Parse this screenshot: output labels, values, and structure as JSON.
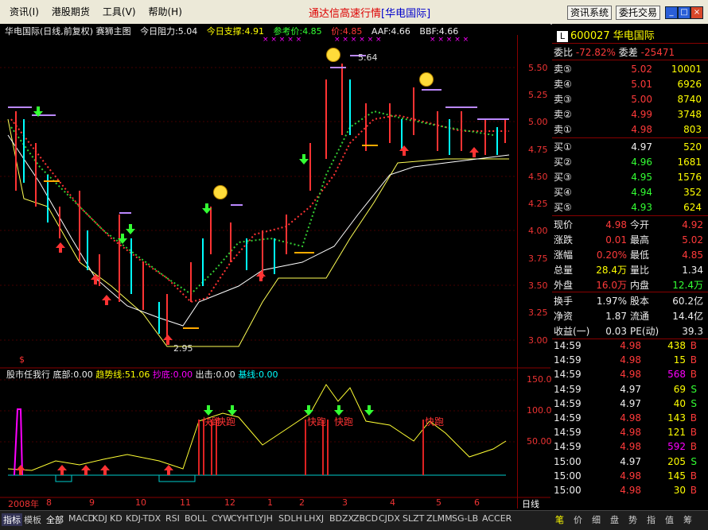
{
  "menu": {
    "items": [
      "资讯(I)",
      "港股期货",
      "工具(V)",
      "帮助(H)"
    ]
  },
  "app_title": "通达信高速行情",
  "app_broker": "[华电国际]",
  "toolbar": {
    "info_system": "资讯系统",
    "trade": "委托交易"
  },
  "chart_header": {
    "name": "华电国际(日线,前复权) 赛狮主图",
    "resistance": "今日阻力:5.04",
    "support": "今日支撑:4.91",
    "ref_price": "参考价:4.85",
    "price": "价:4.85",
    "aaf": "AAF:4.66",
    "bbf": "BBF:4.66"
  },
  "price_axis": [
    "5.50",
    "5.25",
    "5.00",
    "4.75",
    "4.50",
    "4.25",
    "4.00",
    "3.75",
    "3.50",
    "3.25",
    "3.00"
  ],
  "annotations": {
    "high": "5.64",
    "low": "2.95"
  },
  "indicator": {
    "name": "股市任我行",
    "bottom": "底部:0.00",
    "trend": "趋势线:51.06",
    "chaodi": "抄底:0.00",
    "exit": "出击:0.00",
    "base": "基线:0.00",
    "run_label": "快跑",
    "axis": [
      "150.00",
      "100.00",
      "50.00"
    ]
  },
  "x_axis": [
    "2008年",
    "8",
    "9",
    "10",
    "11",
    "12",
    "1",
    "2",
    "3",
    "4",
    "5",
    "6"
  ],
  "period_label": "日线",
  "quote": {
    "code": "600027",
    "name": "华电国际",
    "weibi_label": "委比",
    "weibi": "-72.82%",
    "weicha_label": "委差",
    "weicha": "-25471",
    "asks": [
      {
        "label": "卖⑤",
        "price": "5.02",
        "vol": "10001"
      },
      {
        "label": "卖④",
        "price": "5.01",
        "vol": "6926"
      },
      {
        "label": "卖③",
        "price": "5.00",
        "vol": "8740"
      },
      {
        "label": "卖②",
        "price": "4.99",
        "vol": "3748"
      },
      {
        "label": "卖①",
        "price": "4.98",
        "vol": "803"
      }
    ],
    "bids": [
      {
        "label": "买①",
        "price": "4.97",
        "vol": "520"
      },
      {
        "label": "买②",
        "price": "4.96",
        "vol": "1681"
      },
      {
        "label": "买③",
        "price": "4.95",
        "vol": "1576"
      },
      {
        "label": "买④",
        "price": "4.94",
        "vol": "352"
      },
      {
        "label": "买⑤",
        "price": "4.93",
        "vol": "624"
      }
    ],
    "stats": [
      {
        "l1": "现价",
        "v1": "4.98",
        "l2": "今开",
        "v2": "4.92"
      },
      {
        "l1": "涨跌",
        "v1": "0.01",
        "l2": "最高",
        "v2": "5.02"
      },
      {
        "l1": "涨幅",
        "v1": "0.20%",
        "l2": "最低",
        "v2": "4.85"
      },
      {
        "l1": "总量",
        "v1": "28.4万",
        "l2": "量比",
        "v2": "1.34"
      },
      {
        "l1": "外盘",
        "v1": "16.0万",
        "l2": "内盘",
        "v2": "12.4万"
      }
    ],
    "stats2": [
      {
        "l1": "换手",
        "v1": "1.97%",
        "l2": "股本",
        "v2": "60.2亿"
      },
      {
        "l1": "净资",
        "v1": "1.87",
        "l2": "流通",
        "v2": "14.4亿"
      },
      {
        "l1": "收益(一)",
        "v1": "0.03",
        "l2": "PE(动)",
        "v2": "39.3"
      }
    ],
    "ticks": [
      {
        "t": "14:59",
        "p": "4.98",
        "v": "438",
        "d": "B"
      },
      {
        "t": "14:59",
        "p": "4.98",
        "v": "15",
        "d": "B"
      },
      {
        "t": "14:59",
        "p": "4.98",
        "v": "568",
        "d": "B"
      },
      {
        "t": "14:59",
        "p": "4.97",
        "v": "69",
        "d": "S"
      },
      {
        "t": "14:59",
        "p": "4.97",
        "v": "40",
        "d": "S"
      },
      {
        "t": "14:59",
        "p": "4.98",
        "v": "143",
        "d": "B"
      },
      {
        "t": "14:59",
        "p": "4.98",
        "v": "121",
        "d": "B"
      },
      {
        "t": "14:59",
        "p": "4.98",
        "v": "592",
        "d": "B"
      },
      {
        "t": "15:00",
        "p": "4.97",
        "v": "205",
        "d": "S"
      },
      {
        "t": "15:00",
        "p": "4.98",
        "v": "145",
        "d": "B"
      },
      {
        "t": "15:00",
        "p": "4.98",
        "v": "30",
        "d": "B"
      }
    ]
  },
  "bottom_tabs": [
    "指标",
    "模板",
    "全部",
    "MACD",
    "KDJ",
    "KD",
    "KDJ-TDX",
    "RSI",
    "BOLL",
    "CYW",
    "CYHT",
    "LYJH",
    "SDLH",
    "LHXJ",
    "BDZX",
    "ZBCD",
    "CJDX",
    "SLZT",
    "ZLMM",
    "SG-LB",
    "ACCER"
  ],
  "right_tabs": [
    "笔",
    "价",
    "细",
    "盘",
    "势",
    "指",
    "值",
    "筹"
  ]
}
